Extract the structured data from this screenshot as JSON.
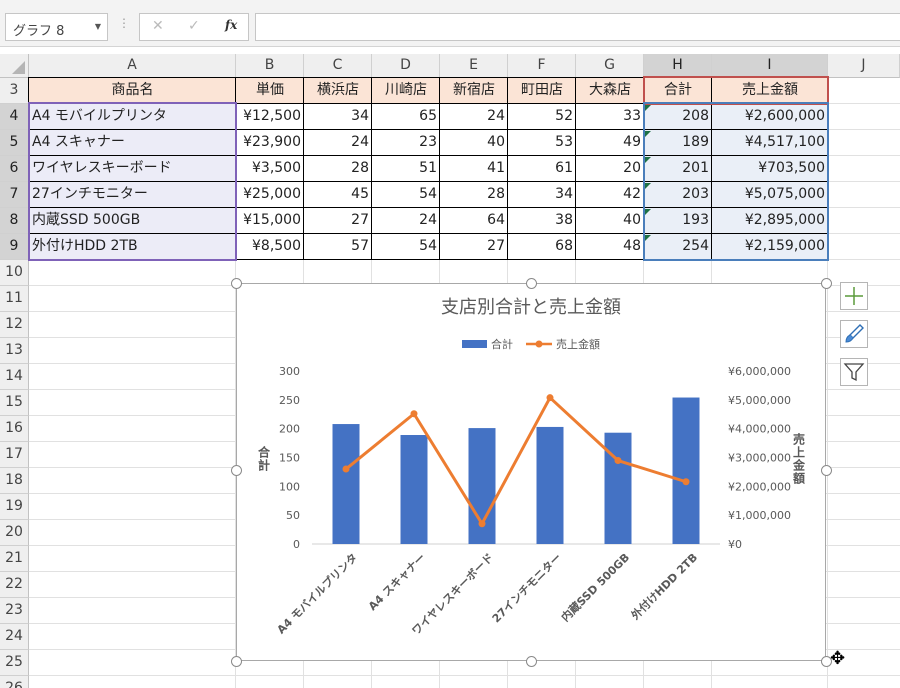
{
  "formula_bar": {
    "name_box": "グラフ 8",
    "cancel_symbol": "✕",
    "enter_symbol": "✓",
    "fx_label": "fx",
    "formula": ""
  },
  "columns": [
    "A",
    "B",
    "C",
    "D",
    "E",
    "F",
    "G",
    "H",
    "I",
    "J"
  ],
  "rows": [
    "3",
    "4",
    "5",
    "6",
    "7",
    "8",
    "9",
    "10",
    "11",
    "12",
    "13",
    "14",
    "15",
    "16",
    "17",
    "18",
    "19",
    "20",
    "21",
    "22",
    "23",
    "24",
    "25",
    "26"
  ],
  "table": {
    "headers": [
      "商品名",
      "単価",
      "横浜店",
      "川崎店",
      "新宿店",
      "町田店",
      "大森店",
      "合計",
      "売上金額"
    ],
    "rows": [
      [
        "A4 モバイルプリンタ",
        "¥12,500",
        "34",
        "65",
        "24",
        "52",
        "33",
        "208",
        "¥2,600,000"
      ],
      [
        "A4 スキャナー",
        "¥23,900",
        "24",
        "23",
        "40",
        "53",
        "49",
        "189",
        "¥4,517,100"
      ],
      [
        "ワイヤレスキーボード",
        "¥3,500",
        "28",
        "51",
        "41",
        "61",
        "20",
        "201",
        "¥703,500"
      ],
      [
        "27インチモニター",
        "¥25,000",
        "45",
        "54",
        "28",
        "34",
        "42",
        "203",
        "¥5,075,000"
      ],
      [
        "内蔵SSD 500GB",
        "¥15,000",
        "27",
        "24",
        "64",
        "38",
        "40",
        "193",
        "¥2,895,000"
      ],
      [
        "外付けHDD 2TB",
        "¥8,500",
        "57",
        "54",
        "27",
        "68",
        "48",
        "254",
        "¥2,159,000"
      ]
    ]
  },
  "chart_data": {
    "type": "bar",
    "combo": "bar+line (secondary axis)",
    "title": "支店別合計と売上金額",
    "categories": [
      "A4 モバイルプリンタ",
      "A4 スキャナー",
      "ワイヤレスキーボード",
      "27インチモニター",
      "内蔵SSD 500GB",
      "外付けHDD 2TB"
    ],
    "series": [
      {
        "name": "合計",
        "type": "bar",
        "axis": "primary",
        "color": "#4472c4",
        "values": [
          208,
          189,
          201,
          203,
          193,
          254
        ]
      },
      {
        "name": "売上金額",
        "type": "line",
        "axis": "secondary",
        "color": "#ed7d31",
        "values": [
          2600000,
          4517100,
          703500,
          5075000,
          2895000,
          2159000
        ]
      }
    ],
    "ylabel": "合計",
    "y2label": "売上金額",
    "ylim": [
      0,
      300
    ],
    "y_ticks": [
      0,
      50,
      100,
      150,
      200,
      250,
      300
    ],
    "y2lim": [
      0,
      6000000
    ],
    "y2_ticks": [
      "¥0",
      "¥1,000,000",
      "¥2,000,000",
      "¥3,000,000",
      "¥4,000,000",
      "¥5,000,000",
      "¥6,000,000"
    ],
    "legend_position": "top",
    "grid": false
  },
  "chart_buttons": {
    "add_element_icon": "plus-icon",
    "style_icon": "brush-icon",
    "filter_icon": "filter-icon"
  }
}
